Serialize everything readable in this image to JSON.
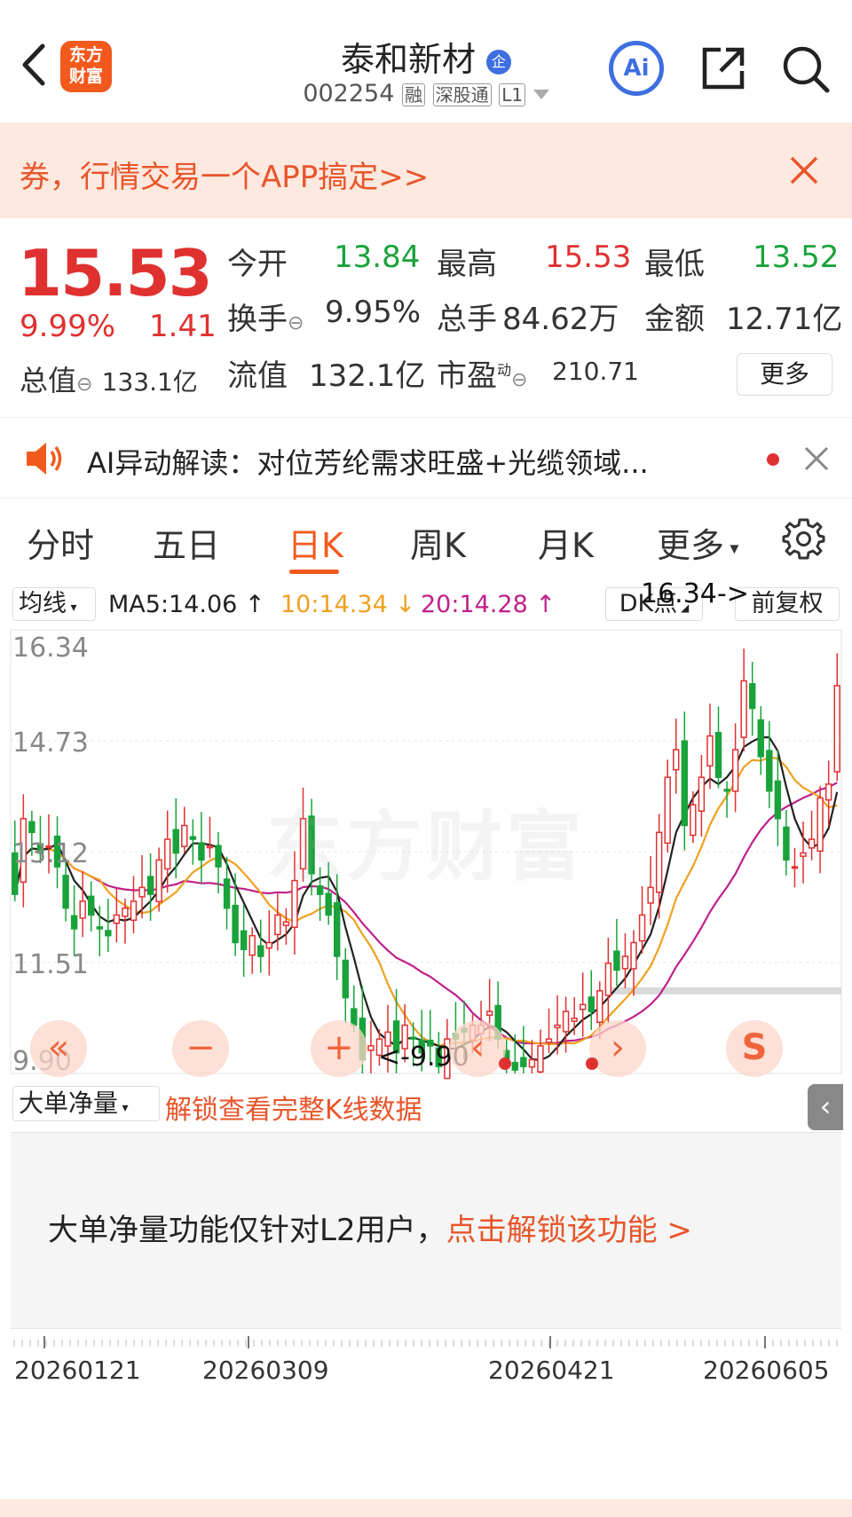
{
  "header": {
    "title": "泰和新材",
    "enterprise_badge": "企",
    "code": "002254",
    "tags": [
      "融",
      "深股通",
      "L1"
    ],
    "logo_line1": "东方",
    "logo_line2": "财富",
    "ai_label": "Ai"
  },
  "banner": {
    "text": "券，行情交易一个APP搞定>>"
  },
  "quote": {
    "price": "15.53",
    "change_pct": "9.99%",
    "change": "1.41",
    "open_label": "今开",
    "open": "13.84",
    "high_label": "最高",
    "high": "15.53",
    "low_label": "最低",
    "low": "13.52",
    "turnover_label": "换手",
    "turnover": "9.95%",
    "volume_label": "总手",
    "volume": "84.62万",
    "amount_label": "金额",
    "amount": "12.71亿",
    "mktcap_label": "总值",
    "mktcap": "133.1亿",
    "float_label": "流值",
    "float": "132.1亿",
    "pe_label": "市盈",
    "pe_sup": "动",
    "pe": "210.71",
    "more": "更多"
  },
  "ai_bar": {
    "text": "AI异动解读：对位芳纶需求旺盛+光缆领域..."
  },
  "tabs": {
    "items": [
      "分时",
      "五日",
      "日K",
      "周K",
      "月K",
      "更多"
    ],
    "active": 2
  },
  "ma_bar": {
    "selector": "均线",
    "ma5": "MA5:14.06 ↑",
    "ma10": "10:14.34 ↓",
    "ma20": "20:14.28 ↑",
    "dk": "DK点",
    "adjust": "前复权"
  },
  "chart_data": {
    "type": "candlestick",
    "y_ticks": [
      "16.34",
      "14.73",
      "13.12",
      "11.51",
      "9.90"
    ],
    "ylim": [
      9.9,
      16.34
    ],
    "max_label": "16.34->",
    "min_label": "<-9.90",
    "x_ticks": [
      "20260121",
      "20260309",
      "20260421",
      "20260605"
    ],
    "ma_colors": {
      "ma5": "#222222",
      "ma10": "#f0a020",
      "ma20": "#c0208a"
    },
    "up_color": "#e03131",
    "down_color": "#19a33a",
    "watermark": "东方财富",
    "closes": [
      12.5,
      13.6,
      13.4,
      13.1,
      13.2,
      12.9,
      12.3,
      12.0,
      12.4,
      12.2,
      12.0,
      11.9,
      12.2,
      12.3,
      12.4,
      12.6,
      12.5,
      13.0,
      13.3,
      13.1,
      13.5,
      13.3,
      13.0,
      13.2,
      12.9,
      12.3,
      11.8,
      11.7,
      11.9,
      11.6,
      11.8,
      12.2,
      12.1,
      12.7,
      13.6,
      12.8,
      12.5,
      12.2,
      11.6,
      11.0,
      10.6,
      10.1,
      10.3,
      10.4,
      10.5,
      10.2,
      10.6,
      10.4,
      10.2,
      10.3,
      10.0,
      10.4,
      10.4,
      10.5,
      10.6,
      10.6,
      10.8,
      10.4,
      10.1,
      9.95,
      10.0,
      10.1,
      10.3,
      10.4,
      10.6,
      10.8,
      10.7,
      10.9,
      10.8,
      11.1,
      11.5,
      11.4,
      11.6,
      11.8,
      12.2,
      12.6,
      13.4,
      14.2,
      14.6,
      13.5,
      13.8,
      14.2,
      14.8,
      14.2,
      14.0,
      14.6,
      15.6,
      15.2,
      14.5,
      14.0,
      13.6,
      13.0,
      12.9,
      13.1,
      13.3,
      13.9,
      14.1,
      15.53
    ]
  },
  "controls": {
    "prev": "«",
    "zoom_out": "−",
    "zoom_in": "+",
    "left": "‹",
    "right": "›",
    "s": "S"
  },
  "indicator": {
    "selector": "大单净量",
    "unlock_text": "解锁查看完整K线数据",
    "body_prefix": "大单净量功能仅针对L2用户，",
    "body_link": "点击解锁该功能 >"
  }
}
